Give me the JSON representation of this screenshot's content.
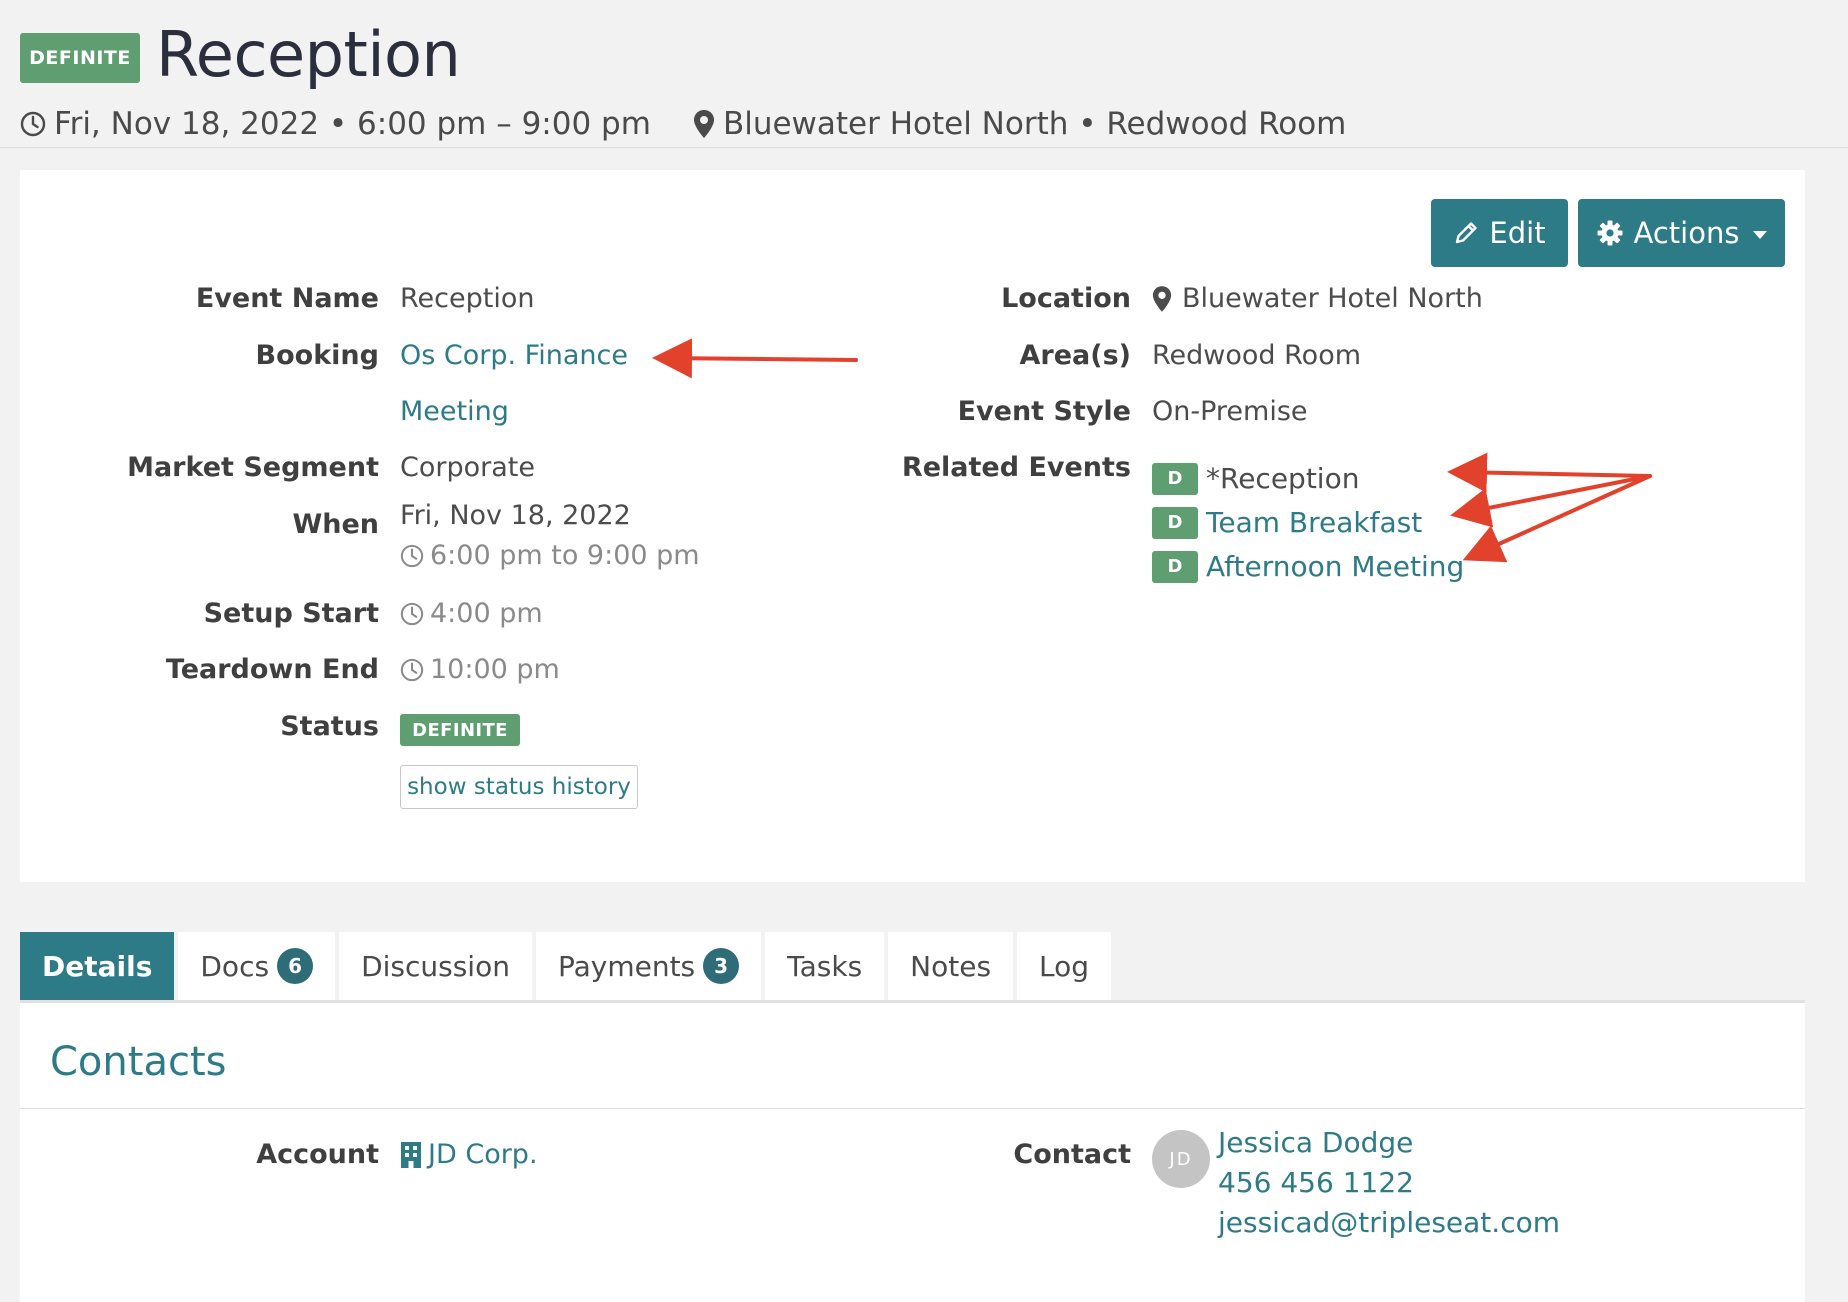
{
  "header": {
    "status_badge": "DEFINITE",
    "title": "Reception",
    "datetime": "Fri, Nov 18, 2022 • 6:00 pm – 9:00 pm",
    "location": "Bluewater Hotel North • Redwood Room"
  },
  "toolbar": {
    "edit_label": "Edit",
    "actions_label": "Actions"
  },
  "details": {
    "event_name_label": "Event Name",
    "event_name": "Reception",
    "booking_label": "Booking",
    "booking_link": "Os Corp. Finance",
    "booking_link2": "Meeting",
    "market_segment_label": "Market Segment",
    "market_segment": "Corporate",
    "when_label": "When",
    "when_date": "Fri, Nov 18, 2022",
    "when_time": "6:00 pm to 9:00 pm",
    "setup_start_label": "Setup Start",
    "setup_start": "4:00 pm",
    "teardown_end_label": "Teardown End",
    "teardown_end": "10:00 pm",
    "status_label": "Status",
    "status": "DEFINITE",
    "status_history_label": "show status history",
    "location_label": "Location",
    "location": "Bluewater Hotel North",
    "areas_label": "Area(s)",
    "areas": "Redwood Room",
    "event_style_label": "Event Style",
    "event_style": "On-Premise",
    "related_events_label": "Related Events",
    "related_events": [
      {
        "badge": "D",
        "name": "*Reception"
      },
      {
        "badge": "D",
        "name": "Team Breakfast"
      },
      {
        "badge": "D",
        "name": "Afternoon Meeting"
      }
    ]
  },
  "tabs": [
    {
      "label": "Details",
      "active": true
    },
    {
      "label": "Docs",
      "count": "6"
    },
    {
      "label": "Discussion"
    },
    {
      "label": "Payments",
      "count": "3"
    },
    {
      "label": "Tasks"
    },
    {
      "label": "Notes"
    },
    {
      "label": "Log"
    }
  ],
  "contacts": {
    "title": "Contacts",
    "account_label": "Account",
    "account": "JD Corp.",
    "contact_label": "Contact",
    "avatar_initials": "JD",
    "contact_name": "Jessica Dodge",
    "contact_phone": "456 456 1122",
    "contact_email": "jessicad@tripleseat.com"
  },
  "colors": {
    "accent": "#2e7b88",
    "definite": "#5e9e70",
    "annotation_arrow": "#e2412b"
  },
  "icons": [
    "clock-icon",
    "map-pin-icon",
    "pencil-icon",
    "gear-icon",
    "building-icon"
  ]
}
